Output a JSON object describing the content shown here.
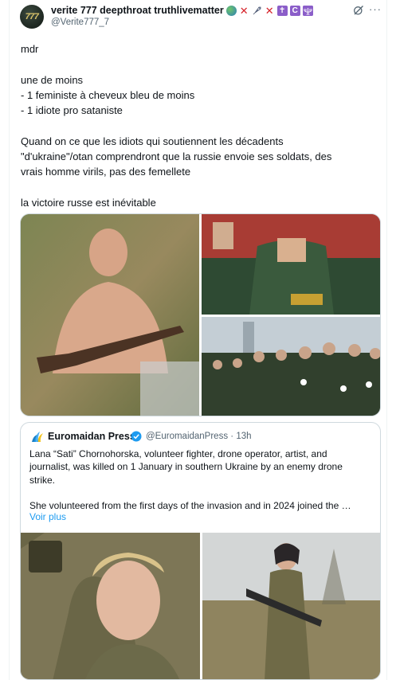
{
  "author": {
    "avatar_text": "777",
    "display_name": "verite 777 deepthroat truthlivematter",
    "handle": "@Verite777_7",
    "name_emojis": [
      "globe-emoji",
      "cross-mark-emoji",
      "rocket-emoji",
      "cross-mark-emoji",
      "latin-cross-emoji",
      "c-emoji",
      "menorah-emoji"
    ]
  },
  "tweet": {
    "lines": [
      "mdr",
      "",
      "une de moins",
      "- 1 feministe à cheveux bleu de moins",
      "- 1 idiote pro sataniste",
      "",
      "Quand on ce que les idiots qui soutiennent les décadents",
      "\"d'ukraine\"/otan comprendront que la russie envoie ses soldats, des",
      "vrais homme virils, pas des femellete",
      "",
      "la victoire russe est inévitable"
    ]
  },
  "emoji_glyphs": {
    "cross": "✕",
    "latin_cross": "✝",
    "c": "C",
    "menorah": "🕎"
  },
  "quoted": {
    "name": "Euromaidan Press",
    "handle": "@EuromaidanPress",
    "separator": "·",
    "time": "13h",
    "text_lines": [
      "Lana “Sati” Chornohorska, volunteer fighter, drone operator, artist, and",
      "journalist, was killed on 1 January in southern Ukraine by an enemy drone",
      "strike.",
      "",
      "She volunteered from the first days of the invasion and in 2024 joined the …"
    ],
    "show_more": "Voir plus"
  },
  "colors": {
    "link": "#1d9bf0",
    "secondary_text": "#536471",
    "border": "#cfd9de",
    "verified": "#1d9bf0"
  }
}
